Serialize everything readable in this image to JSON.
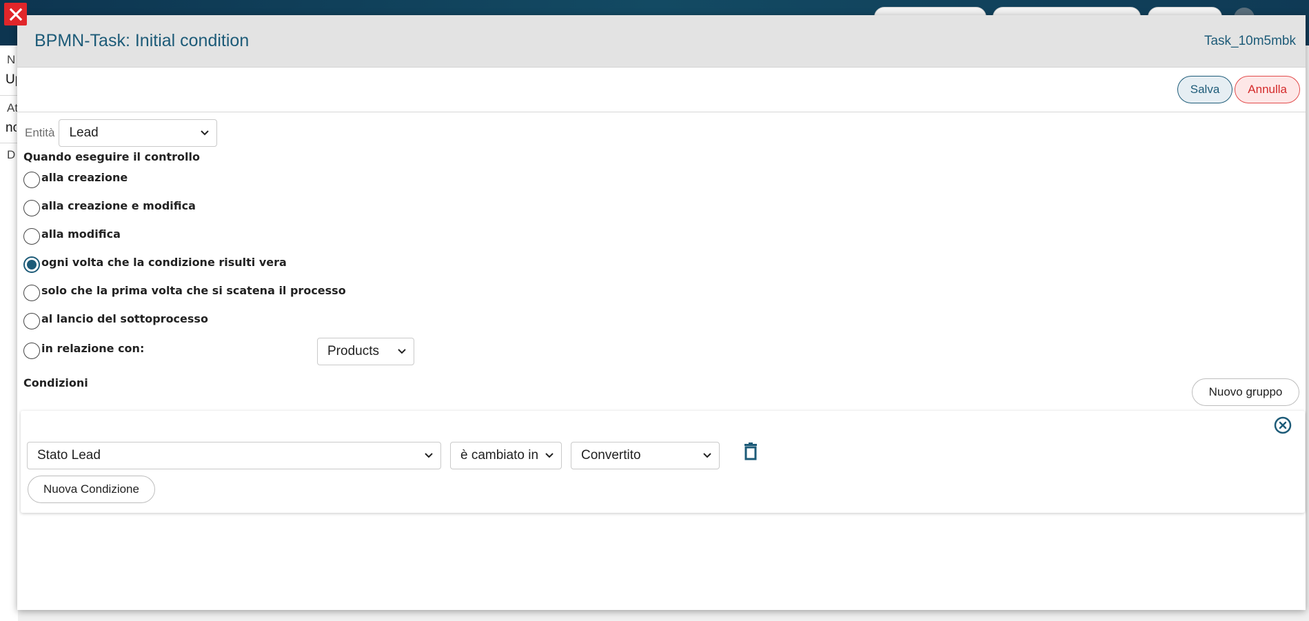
{
  "background": {
    "left_fragments": [
      "N",
      "Up",
      "At",
      "nc",
      "D"
    ]
  },
  "modal": {
    "title": "BPMN-Task: Initial condition",
    "task_id": "Task_10m5mbk",
    "toolbar": {
      "save_label": "Salva",
      "cancel_label": "Annulla"
    },
    "entity": {
      "label": "Entità",
      "value": "Lead"
    },
    "when_section": {
      "title": "Quando eseguire il controllo",
      "options": [
        {
          "label": "alla creazione",
          "checked": false
        },
        {
          "label": "alla creazione e modifica",
          "checked": false
        },
        {
          "label": "alla modifica",
          "checked": false
        },
        {
          "label": "ogni volta che la condizione risulti vera",
          "checked": true
        },
        {
          "label": "solo che la prima volta che si scatena il processo",
          "checked": false
        },
        {
          "label": "al lancio del sottoprocesso",
          "checked": false
        },
        {
          "label": "in relazione con:",
          "checked": false
        }
      ],
      "relation_value": "Products"
    },
    "conditions": {
      "title": "Condizioni",
      "new_group_label": "Nuovo gruppo",
      "group": {
        "field_value": "Stato Lead",
        "operator_value": "è cambiato in",
        "target_value": "Convertito",
        "new_condition_label": "Nuova Condizione"
      }
    }
  },
  "colors": {
    "accent": "#1d5b78",
    "danger": "#e1262a",
    "header_bg": "#e3e3e3",
    "topbar": "#134a63"
  },
  "icons": {
    "close": "close-icon",
    "remove_group": "circle-x-icon",
    "delete_condition": "trash-icon"
  }
}
